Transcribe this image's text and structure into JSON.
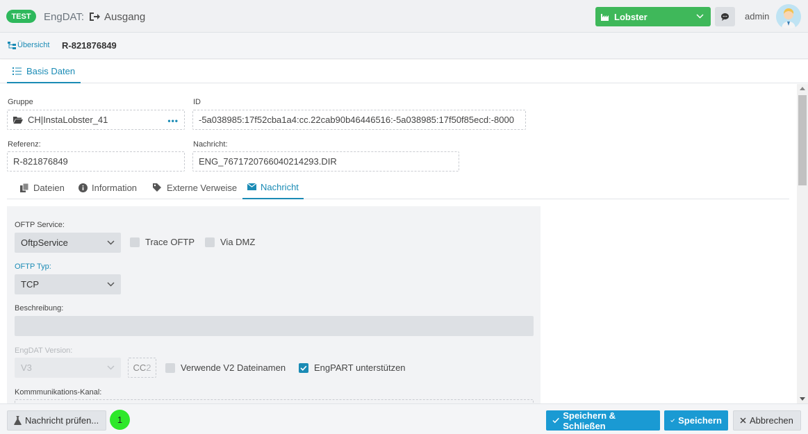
{
  "header": {
    "env_badge": "TEST",
    "app_name": "EngDAT:",
    "section_title": "Ausgang",
    "tenant": "Lobster",
    "username": "admin"
  },
  "breadcrumb": {
    "overview_label": "Übersicht",
    "record_title": "R-821876849"
  },
  "main_tabs": [
    {
      "label": "Basis Daten",
      "active": true
    }
  ],
  "form": {
    "gruppe_label": "Gruppe",
    "gruppe_value": "CH|InstaLobster_41",
    "id_label": "ID",
    "id_value": "-5a038985:17f52cba1a4:cc.22cab90b46446516:-5a038985:17f50f85ecd:-8000",
    "referenz_label": "Referenz:",
    "referenz_value": "R-821876849",
    "nachricht_label": "Nachricht:",
    "nachricht_value": "ENG_767172076604021429‌3.DIR"
  },
  "sub_tabs": [
    {
      "label": "Dateien",
      "icon": "files-icon",
      "active": false
    },
    {
      "label": "Information",
      "icon": "info-icon",
      "active": false
    },
    {
      "label": "Externe Verweise",
      "icon": "tags-icon",
      "active": false
    },
    {
      "label": "Nachricht",
      "icon": "envelope-icon",
      "active": true
    }
  ],
  "nachricht": {
    "oftp_service_label": "OFTP Service:",
    "oftp_service_value": "OftpService",
    "trace_oftp_label": "Trace OFTP",
    "trace_oftp_checked": false,
    "via_dmz_label": "Via DMZ",
    "via_dmz_checked": false,
    "oftp_typ_label": "OFTP Typ:",
    "oftp_typ_value": "TCP",
    "beschreibung_label": "Beschreibung:",
    "beschreibung_value": "",
    "engdat_version_label": "EngDAT Version:",
    "engdat_version_value": "V3",
    "cc_main": "CC",
    "cc_sub": "2",
    "v2_dateinamen_label": "Verwende V2 Dateinamen",
    "v2_dateinamen_checked": false,
    "engpart_label": "EngPART unterstützen",
    "engpart_checked": true,
    "kanal_label": "Kommmunikations-Kanal:"
  },
  "footer": {
    "check_button": "Nachricht prüfen...",
    "counter": "1",
    "save_close_button": "Speichern & Schließen",
    "save_button": "Speichern",
    "cancel_button": "Abbrechen"
  },
  "colors": {
    "accent": "#1a8bb5",
    "primary_button": "#1a9ad3",
    "tenant_green": "#3fb85a",
    "badge_green": "#2eb85c",
    "counter_green": "#2ee82a"
  }
}
